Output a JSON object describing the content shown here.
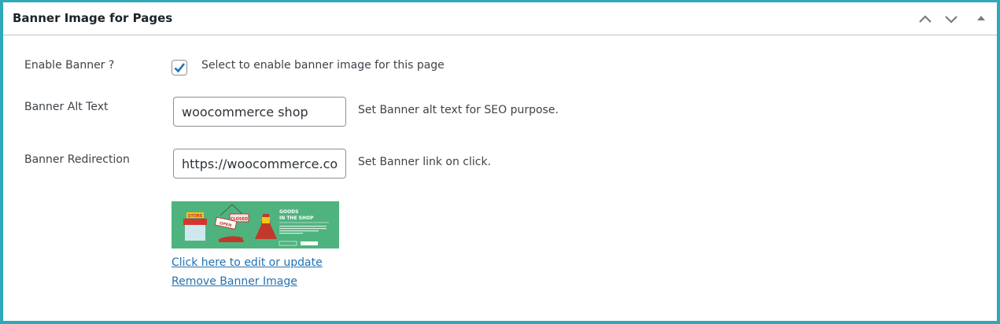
{
  "panel": {
    "title": "Banner Image for Pages",
    "colors": {
      "frame": "#2fa9b8",
      "link": "#2271b1",
      "banner_bg": "#4fb37f"
    }
  },
  "enable": {
    "label": "Enable Banner ?",
    "checked": true,
    "description": "Select to enable banner image for this page"
  },
  "alt": {
    "label": "Banner Alt Text",
    "value": "woocommerce shop",
    "description": "Set Banner alt text for SEO purpose."
  },
  "redirect": {
    "label": "Banner Redirection",
    "value": "https://woocommerce.com",
    "description": "Set Banner link on click."
  },
  "image": {
    "heading_line1": "GOODS",
    "heading_line2": "IN THE SHOP",
    "sign_store": "STORE",
    "sign_open": "OPEN",
    "sign_closed": "CLOSED",
    "edit_link": "Click here to edit or update",
    "remove_link": "Remove Banner Image"
  }
}
